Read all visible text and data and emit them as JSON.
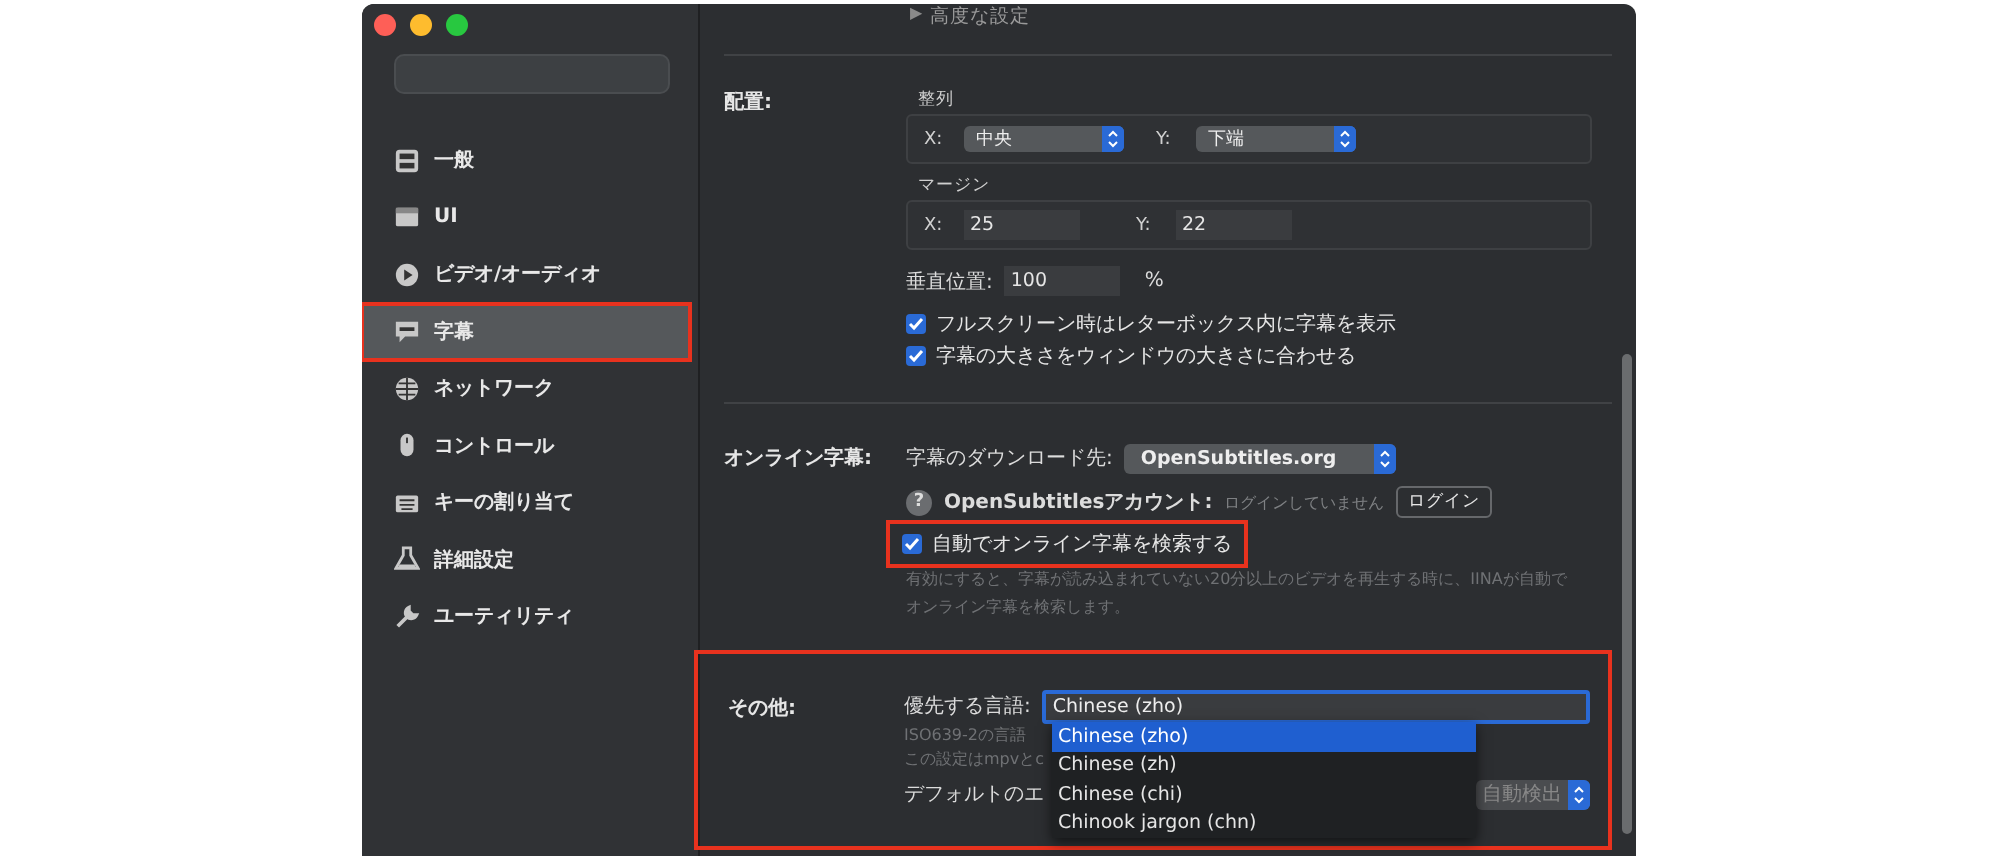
{
  "sidebar": {
    "items": [
      {
        "label": "一般",
        "selected": false,
        "highlighted": false
      },
      {
        "label": "UI",
        "selected": false,
        "highlighted": false
      },
      {
        "label": "ビデオ/オーディオ",
        "selected": false,
        "highlighted": false
      },
      {
        "label": "字幕",
        "selected": true,
        "highlighted": true
      },
      {
        "label": "ネットワーク",
        "selected": false,
        "highlighted": false
      },
      {
        "label": "コントロール",
        "selected": false,
        "highlighted": false
      },
      {
        "label": "キーの割り当て",
        "selected": false,
        "highlighted": false
      },
      {
        "label": "詳細設定",
        "selected": false,
        "highlighted": false
      },
      {
        "label": "ユーティリティ",
        "selected": false,
        "highlighted": false
      }
    ]
  },
  "advanced": {
    "label": "高度な設定",
    "disclosure": "▶"
  },
  "placement": {
    "label": "配置:",
    "alignment": {
      "label": "整列",
      "x_label": "X:",
      "x_value": "中央",
      "y_label": "Y:",
      "y_value": "下端"
    },
    "margin": {
      "label": "マージン",
      "x_label": "X:",
      "x_value": "25",
      "y_label": "Y:",
      "y_value": "22"
    },
    "vertical": {
      "label": "垂直位置:",
      "value": "100",
      "unit": "%"
    },
    "checkboxes": [
      {
        "label": "フルスクリーン時はレターボックス内に字幕を表示",
        "checked": true
      },
      {
        "label": "字幕の大きさをウィンドウの大きさに合わせる",
        "checked": true
      }
    ]
  },
  "online": {
    "label": "オンライン字幕:",
    "download_label": "字幕のダウンロード先:",
    "download_value": "OpenSubtitles.org",
    "help": "?",
    "account_label": "OpenSubtitlesアカウント:",
    "account_status": "ログインしていません",
    "login_button": "ログイン",
    "auto": {
      "label": "自動でオンライン字幕を検索する",
      "checked": true,
      "highlighted": true
    },
    "description": "有効にすると、字幕が読み込まれていない20分以上のビデオを再生する時に、IINAが自動でオンライン字幕を検索します。"
  },
  "other": {
    "label": "その他:",
    "highlighted": true,
    "preferred_label": "優先する言語:",
    "preferred_value": "Chinese (zho)",
    "hint_lines": [
      "ISO639-2の言語",
      "この設定はmpvとc"
    ],
    "encoding_label": "デフォルトのエ",
    "encoding_value": "自動検出",
    "suggestions": [
      {
        "label": "Chinese (zho)",
        "selected": true
      },
      {
        "label": "Chinese (zh)",
        "selected": false
      },
      {
        "label": "Chinese (chi)",
        "selected": false
      },
      {
        "label": "Chinook jargon (chn)",
        "selected": false
      }
    ]
  }
}
